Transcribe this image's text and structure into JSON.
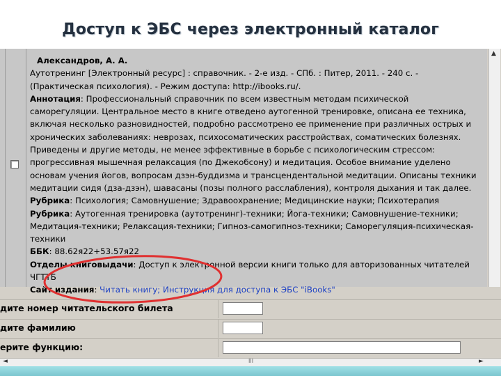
{
  "slide": {
    "title": "Доступ к ЭБС через электронный каталог"
  },
  "record": {
    "lines": [
      {
        "label": "",
        "text": "Александров, А. А.",
        "style": "author"
      },
      {
        "label": "",
        "text": "Аутотренинг [Электронный ресурс] : справочник. - 2-е изд. - СПб. : Питер, 2011. - 240 с. -",
        "style": "plain"
      },
      {
        "label": "",
        "text": "(Практическая психология). - Режим доступа: http://ibooks.ru/.",
        "style": "plain"
      },
      {
        "label": "Аннотация",
        "text": ":  Профессиональный справочник по всем известным методам психической",
        "style": "labeled"
      },
      {
        "label": "",
        "text": "саморегуляции. Центральное место в книге отведено аутогенной тренировке, описана ее техника,",
        "style": "plain"
      },
      {
        "label": "",
        "text": "включая несколько разновидностей, подробно рассмотрено ее применение при различных острых и",
        "style": "plain"
      },
      {
        "label": "",
        "text": "хронических заболеваниях: неврозах, психосоматических расстройствах, соматических болезнях.",
        "style": "plain"
      },
      {
        "label": "",
        "text": "Приведены и другие методы, не менее эффективные в борьбе с психологическим стрессом:",
        "style": "plain"
      },
      {
        "label": "",
        "text": "прогрессивная мышечная релаксация (по Джекобсону) и медитация. Особое внимание уделено",
        "style": "plain"
      },
      {
        "label": "",
        "text": "основам учения йогов, вопросам дзэн-буддизма и трансцендентальной медитации. Описаны техники",
        "style": "plain"
      },
      {
        "label": "",
        "text": "медитации сидя (дза-дзэн), шавасаны (позы полного расслабления), контроля дыхания и так далее.",
        "style": "plain"
      },
      {
        "label": "Рубрика",
        "text": ":  Психология; Самовнушение; Здравоохранение; Медицинские науки; Психотерапия",
        "style": "labeled"
      },
      {
        "label": "Рубрика",
        "text": ":  Аутогенная тренировка (аутотренинг)-техники; Йога-техники; Самовнушение-техники;",
        "style": "labeled"
      },
      {
        "label": "",
        "text": "Медитация-техники; Релаксация-техники; Гипноз-самогипноз-техники; Саморегуляция-психическая-",
        "style": "plain"
      },
      {
        "label": "",
        "text": "техники",
        "style": "plain"
      },
      {
        "label": "ББК",
        "text": ":  88.62я22+53.57я22",
        "style": "labeled"
      },
      {
        "label": "Отделы книговыдачи",
        "text": ":  Доступ к электронной версии книги только для авторизованных читателей",
        "style": "labeled"
      },
      {
        "label": "",
        "text": "ЧГТТБ",
        "style": "plain"
      }
    ],
    "site_label": "Сайт издания",
    "site_colon": ": ",
    "site_links": "Читать книгу; Инструкция для доступа к ЭБС \"iBooks\""
  },
  "form": {
    "row1_label": "дите номер читательского билета",
    "row2_label": "дите фамилию",
    "row3_label": "ерите функцию:"
  },
  "scrollbar": {
    "up_arrow": "▲",
    "left_arrow": "◄",
    "right_arrow": "►",
    "thumb": "III"
  },
  "colors": {
    "annotation_circle": "#e03030",
    "link": "#1a3fc4",
    "taskbar": "#8fd3db"
  }
}
